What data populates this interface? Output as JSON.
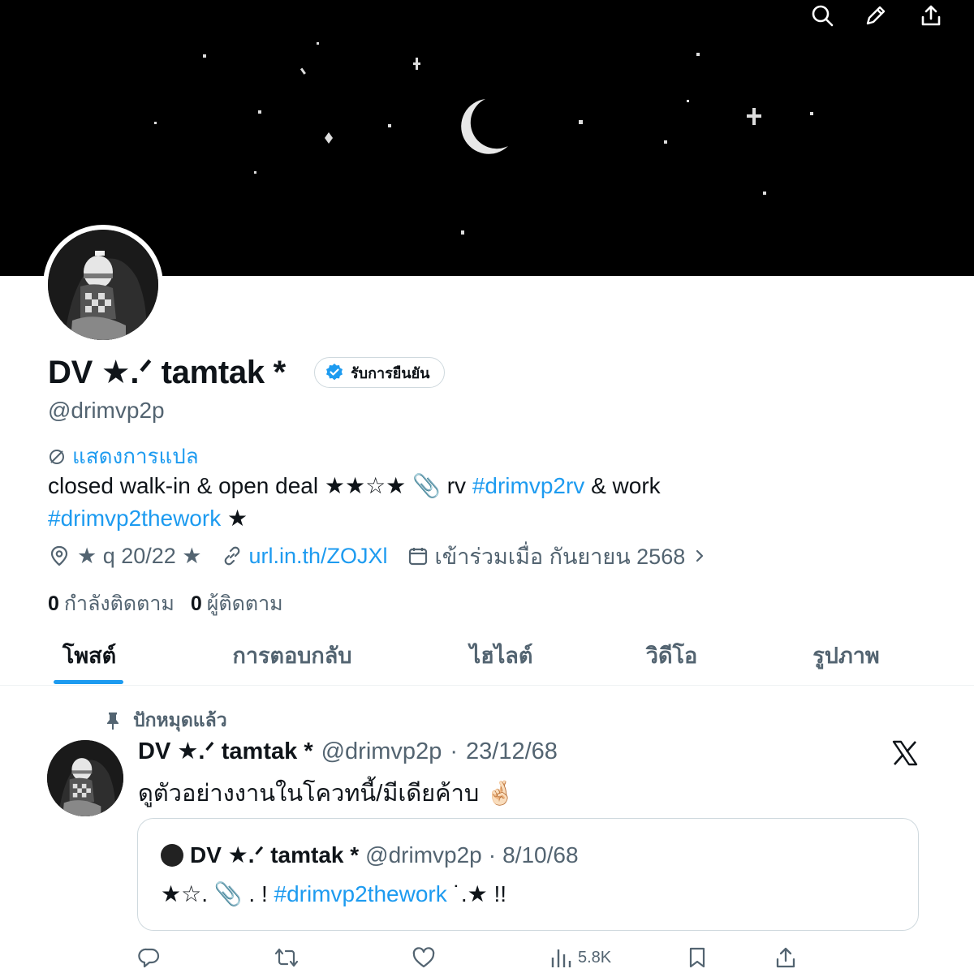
{
  "header": {
    "actions": [
      {
        "name": "search-icon"
      },
      {
        "name": "edit-icon"
      },
      {
        "name": "share-icon"
      }
    ]
  },
  "profile": {
    "display_name": "DV ★.ᐟ tamtak *",
    "verify_badge_label": "รับการยืนยัน",
    "handle": "@drimvp2p",
    "translate_label": "แสดงการแปล",
    "bio": {
      "line1_a": "closed walk-in & open deal ★★☆★ 📎 rv ",
      "line1_tag": "#drimvp2rv",
      "line1_b": " & work",
      "line2_tag": "#drimvp2thework",
      "line2_b": " ★"
    },
    "location": "★ q 20/22 ★",
    "website": "url.in.th/ZOJXl",
    "joined": "เข้าร่วมเมื่อ กันยายน 2568",
    "following_count": "0",
    "following_label": "กำลังติดตาม",
    "followers_count": "0",
    "followers_label": "ผู้ติดตาม"
  },
  "tabs": [
    {
      "label": "โพสต์",
      "active": true
    },
    {
      "label": "การตอบกลับ",
      "active": false
    },
    {
      "label": "ไฮไลต์",
      "active": false
    },
    {
      "label": "วิดีโอ",
      "active": false
    },
    {
      "label": "รูปภาพ",
      "active": false
    }
  ],
  "post": {
    "pinned_label": "ปักหมุดแล้ว",
    "author": "DV ★.ᐟ tamtak *",
    "handle": "@drimvp2p",
    "date": "23/12/68",
    "text": "ดูตัวอย่างงานในโควทนี้/มีเดียค้าบ 🤞🏻",
    "quote": {
      "author": "DV ★.ᐟ tamtak *",
      "handle": "@drimvp2p",
      "date": "8/10/68",
      "text_a": "★☆. 📎 . ! ",
      "text_tag": "#drimvp2thework",
      "text_b": " ˙.★ !!"
    },
    "views": "5.8K"
  },
  "colors": {
    "accent": "#1d9bf0",
    "text": "#0f1419",
    "secondary": "#536471"
  }
}
